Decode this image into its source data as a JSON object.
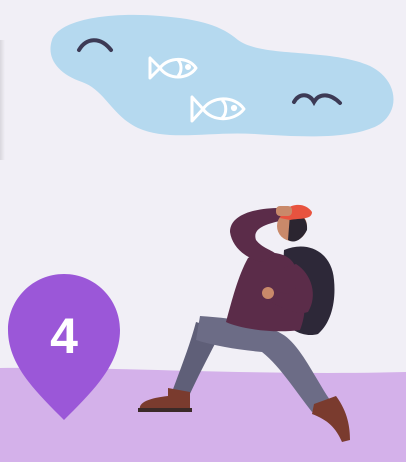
{
  "illustration": {
    "step_marker": {
      "number": "4",
      "color": "#9b57d8"
    },
    "ground": {
      "color": "#d4b1ea"
    },
    "sky_pond": {
      "color": "#b5d9ef"
    },
    "background": "#f1eff6",
    "icons": [
      "fish-icon",
      "fish-icon",
      "bird-icon",
      "bird-icon",
      "hiker-figure"
    ]
  }
}
